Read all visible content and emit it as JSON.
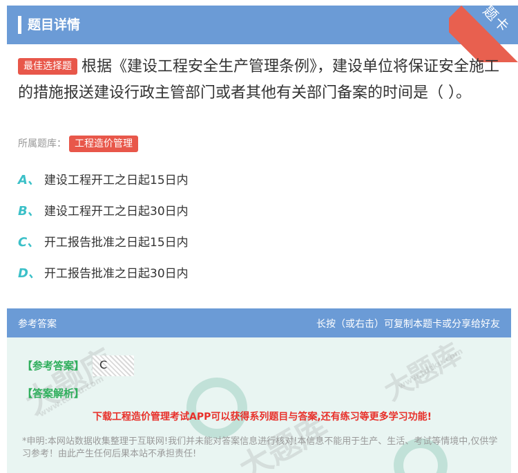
{
  "header": {
    "title": "题目详情",
    "ribbon_label": "题卡"
  },
  "question": {
    "type_tag": "最佳选择题",
    "text": "根据《建设工程安全生产管理条例》，建设单位将保证安全施工的措施报送建设行政主管部门或者其他有关部门备案的时间是（ ）。",
    "category_label": "所属题库：",
    "category": "工程造价管理"
  },
  "options": [
    {
      "letter": "A、",
      "text": "建设工程开工之日起15日内"
    },
    {
      "letter": "B、",
      "text": "建设工程开工之日起30日内"
    },
    {
      "letter": "C、",
      "text": "开工报告批准之日起15日内"
    },
    {
      "letter": "D、",
      "text": "开工报告批准之日起30日内"
    }
  ],
  "answer_panel": {
    "title": "参考答案",
    "hint": "长按（或右击）可复制本题卡或分享给好友",
    "answer_label": "【参考答案】",
    "answer_value": "C",
    "analysis_label": "【答案解析】",
    "promo": "下载工程造价管理考试APP可以获得系列题目与答案,还有练习等更多学习功能!",
    "disclaimer": "*申明:本网站数据收集整理于互联网!我们并未能对答案信息进行核对!本信息不能用于生产、生活、考试等情境中,仅供学习参考！由此产生任何后果本站不承担责任!"
  },
  "watermark": {
    "text": "大题库",
    "url": "www.tdtku.com"
  },
  "colors": {
    "header_blue": "#6b9bd6",
    "tag_red": "#e8574a",
    "option_teal": "#3cc0c8",
    "answer_green": "#2fae5c"
  }
}
